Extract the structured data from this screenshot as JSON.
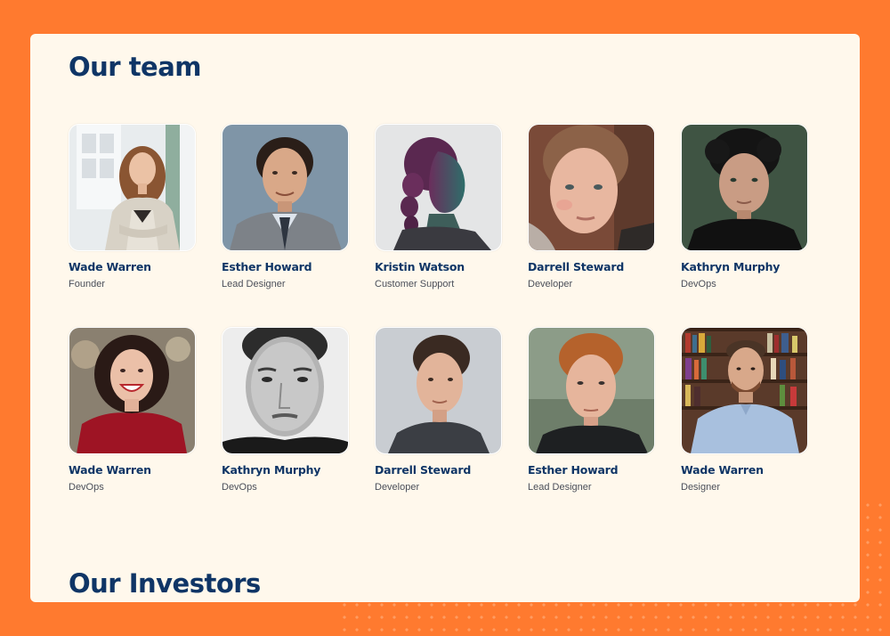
{
  "team_section": {
    "title": "Our team",
    "members": [
      {
        "name": "Wade Warren",
        "role": "Founder",
        "photo": "portrait-woman-blazer-window"
      },
      {
        "name": "Esther Howard",
        "role": "Lead Designer",
        "photo": "portrait-man-grey-sweater"
      },
      {
        "name": "Kristin Watson",
        "role": "Customer Support",
        "photo": "portrait-woman-profile-purple"
      },
      {
        "name": "Darrell Steward",
        "role": "Developer",
        "photo": "portrait-woman-closeup"
      },
      {
        "name": "Kathryn Murphy",
        "role": "DevOps",
        "photo": "portrait-man-curly-hair"
      },
      {
        "name": "Wade Warren",
        "role": "DevOps",
        "photo": "portrait-woman-red-sweater"
      },
      {
        "name": "Kathryn Murphy",
        "role": "DevOps",
        "photo": "portrait-man-black-white"
      },
      {
        "name": "Darrell Steward",
        "role": "Developer",
        "photo": "portrait-man-grey-background"
      },
      {
        "name": "Esther Howard",
        "role": "Lead Designer",
        "photo": "portrait-man-red-hair"
      },
      {
        "name": "Wade Warren",
        "role": "Designer",
        "photo": "portrait-man-bookshelf"
      }
    ]
  },
  "investors_section": {
    "title": "Our Investors"
  },
  "colors": {
    "background": "#FF7A2F",
    "card": "#FFF8EC",
    "heading": "#0F3566",
    "muted": "#4A4F5A"
  }
}
